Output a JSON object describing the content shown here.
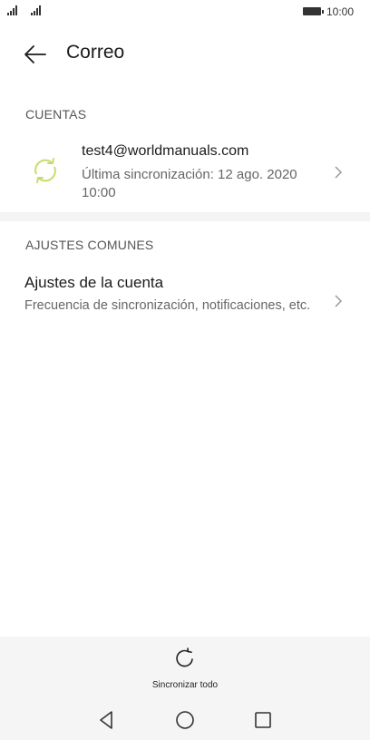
{
  "status_bar": {
    "time": "10:00"
  },
  "header": {
    "title": "Correo"
  },
  "sections": {
    "accounts_label": "CUENTAS",
    "common_label": "AJUSTES COMUNES"
  },
  "account": {
    "email": "test4@worldmanuals.com",
    "last_sync": "Última sincronización: 12 ago. 2020 10:00"
  },
  "settings": {
    "title": "Ajustes de la cuenta",
    "subtitle": "Frecuencia de sincronización, notificaciones, etc."
  },
  "bottom_bar": {
    "sync_all_label": "Sincronizar todo"
  },
  "colors": {
    "sync_accent": "#c9dc6a",
    "background": "#ffffff",
    "bottom_bar": "#f5f5f5"
  },
  "icons": [
    "signal-icon",
    "battery-icon",
    "back-arrow-icon",
    "sync-icon",
    "chevron-right-icon",
    "refresh-icon",
    "nav-back-icon",
    "nav-home-icon",
    "nav-recent-icon"
  ]
}
